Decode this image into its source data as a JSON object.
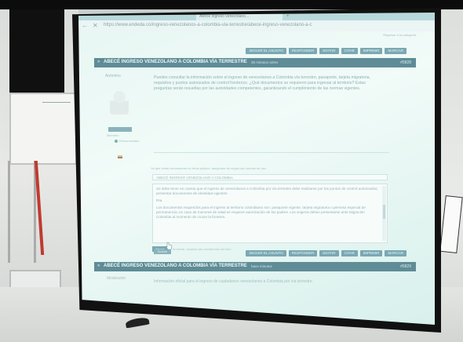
{
  "browser": {
    "tab_title": "Abece ingreso venezolano…",
    "new_tab": "+",
    "url": "https://www.endeda.co/ingreso-venezolanos-a-colombia-via-terrestre/abece-ingreso-venezolano-a-c",
    "top_link": "Regresar a la categoría"
  },
  "toolbar": {
    "buttons": [
      "SEGUIR EL ASUNTO",
      "RESPONDER",
      "EDITAR",
      "CITAR",
      "IMPRIMIR",
      "MARCAR"
    ]
  },
  "post1": {
    "title": "ABECÉ INGRESO VENEZOLANO A COLOMBIA VÍA TERRESTRE",
    "time": "35 minutos antes",
    "number": "#5828",
    "author": "Anónimo",
    "rank": "Miembro",
    "status": "Desconectado",
    "body": "Puedes consultar la información sobre el ingreso de venezolanos a Colombia vía terrestre, pasaporte, tarjeta migratoria, requisitos y puntos autorizados de control fronterizo. ¿Qué documentos se requieren para ingresar al territorio? Estas preguntas serán resueltas por las autoridades competentes, garantizando el cumplimiento de las normas vigentes."
  },
  "reply": {
    "hint": "Ya que estás comentando un tema público, asegúrate de seguir las normas de uso.",
    "subject": "ABECÉ INGRESO VENEZOLANO A COLOMBIA",
    "paragraph1": "Se debe tener en cuenta que el ingreso de venezolanos a Colombia por vía terrestre debe realizarse por los puntos de control autorizados; presentar documentos de identidad vigentes.",
    "paragraph2_label": "Rta.",
    "paragraph2": "Los documentos requeridos para el ingreso al territorio colombiano son: pasaporte vigente, tarjeta migratoria o permiso especial de permanencia; en caso de menores de edad se requiere autorización de los padres. Los viajeros deben presentarse ante Migración Colombia al momento de cruzar la frontera.",
    "send_label": "Enviar",
    "send_note": "Al enviar, aceptas las condiciones del foro",
    "small_button": "Guardar"
  },
  "toolbar2": {
    "buttons": [
      "SEGUIR EL ASUNTO",
      "RESPONDER",
      "EDITAR",
      "CITAR",
      "IMPRIMIR",
      "MARCAR"
    ]
  },
  "post2": {
    "title": "ABECÉ INGRESO VENEZOLANO A COLOMBIA VÍA TERRESTRE",
    "time": "hace minutos",
    "number": "#5829",
    "author": "Moderador",
    "body": "Información oficial para el ingreso de ciudadanos venezolanos a Colombia por vía terrestre."
  },
  "colors": {
    "title_bar": "#5f8c96",
    "button": "#7aa8b3",
    "projection_bg": "#e7f6f3"
  }
}
